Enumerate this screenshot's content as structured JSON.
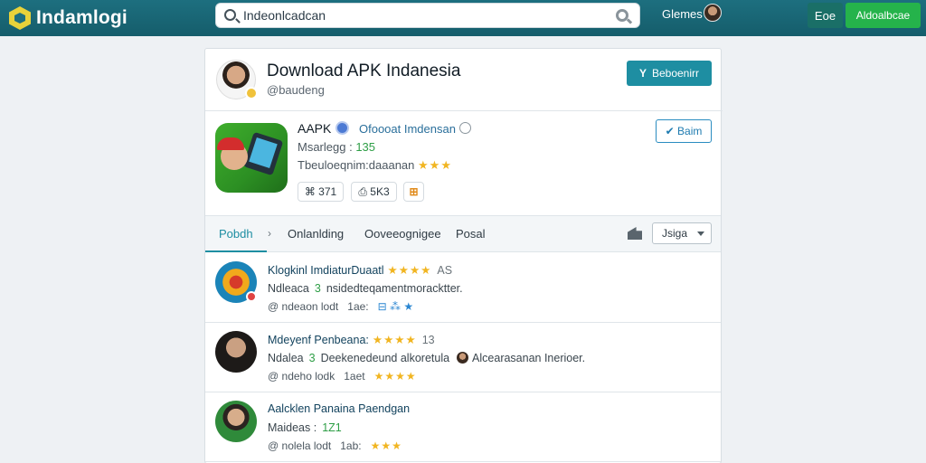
{
  "header": {
    "logo_text": "Indamlogi",
    "search_placeholder": "Indeonlcadcan",
    "games_label": "Glemes",
    "btn_eoe": "Eoe",
    "btn_primary": "Aldoalbcae"
  },
  "publisher": {
    "title": "Download APK Indanesia",
    "handle": "@baudeng",
    "follow_icon": "Y",
    "follow_label": "Beboenirr"
  },
  "app": {
    "name": "AAPK",
    "developer": "Ofoooat Imdensan",
    "meta1_label": "Msarlegg :",
    "meta1_value": "135",
    "meta2_label": "Tbeuloeqnim:daaanan",
    "meta2_stars": "★★★",
    "chips": [
      "⌘ 371",
      "⎙ 5K3",
      "⊞"
    ],
    "share_label": "Baim",
    "share_icon": "✔"
  },
  "tabs": {
    "items": [
      "Pobdh",
      "Onlanlding",
      "Ooveeognigee",
      "Posal"
    ],
    "chev": "›",
    "sort_label": "Jsiga"
  },
  "rows": [
    {
      "title": "Klogkinl ImdiaturDuaatl",
      "stars": "★★★★",
      "count": "AS",
      "l2_label": "Ndleaca",
      "l2_value": "3",
      "l2_text": "nsidedteqamentmoracktter.",
      "l3_handle": "@ ndeaon lodt",
      "l3_date": "1ae:",
      "l3_extra": "⊟ ⁂ ★"
    },
    {
      "title": "Mdeyenf Penbeana:",
      "stars": "★★★★",
      "count": "13",
      "l2_label": "Ndalea",
      "l2_value": "3",
      "l2_text": "Deekenedeund alkoretula",
      "l2_tail": "Alcearasanan Inerioer.",
      "l3_handle": "@ ndeho lodk",
      "l3_date": "1aet",
      "l3_extra": "★★★★"
    },
    {
      "title": "Aalcklen Panaina Paendgan",
      "stars": "",
      "count": "",
      "l2_label": "Maideas :",
      "l2_value": "1Z1",
      "l2_text": "",
      "l3_handle": "@ nolela lodt",
      "l3_date": "1ab:",
      "l3_extra": "★★★"
    }
  ],
  "colors": {
    "topbar": "#1d6f7f",
    "accent": "#1e8ea2",
    "green": "#25b34b",
    "star": "#f1b521"
  }
}
